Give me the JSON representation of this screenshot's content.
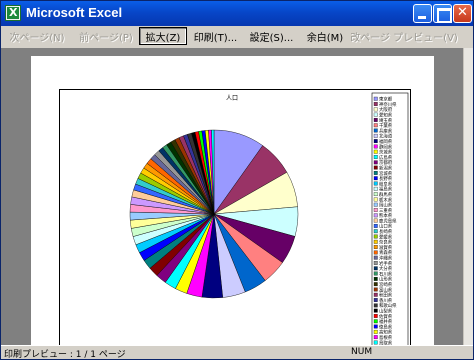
{
  "window": {
    "title": "Microsoft Excel"
  },
  "toolbar": {
    "next_page": "次ページ(N)",
    "prev_page": "前ページ(P)",
    "zoom": "拡大(Z)",
    "print": "印刷(T)...",
    "setup": "設定(S)...",
    "margins": "余白(M)",
    "page_break_preview": "改ページ プレビュー(V)"
  },
  "status": {
    "text": "印刷プレビュー : 1 / 1 ページ",
    "num": "NUM"
  },
  "chart_data": {
    "type": "pie",
    "title": "人口",
    "legend_position": "right",
    "categories": [
      "東京都",
      "神奈川県",
      "大阪府",
      "愛知県",
      "埼玉県",
      "千葉県",
      "兵庫県",
      "北海道",
      "福岡県",
      "静岡県",
      "茨城県",
      "広島県",
      "京都府",
      "新潟県",
      "宮城県",
      "長野県",
      "岐阜県",
      "福島県",
      "群馬県",
      "栃木県",
      "岡山県",
      "三重県",
      "熊本県",
      "鹿児島県",
      "山口県",
      "長崎県",
      "愛媛県",
      "奈良県",
      "滋賀県",
      "青森県",
      "沖縄県",
      "岩手県",
      "大分県",
      "石川県",
      "山形県",
      "宮崎県",
      "富山県",
      "秋田県",
      "香川県",
      "和歌山県",
      "山梨県",
      "佐賀県",
      "福井県",
      "徳島県",
      "高知県",
      "島根県",
      "鳥取県"
    ],
    "values": [
      12577,
      8792,
      8817,
      7255,
      7054,
      6056,
      5591,
      5628,
      5050,
      3792,
      2975,
      2877,
      2648,
      2431,
      2360,
      2196,
      2107,
      2091,
      2024,
      2017,
      1957,
      1867,
      1842,
      1753,
      1493,
      1479,
      1468,
      1421,
      1380,
      1437,
      1361,
      1385,
      1210,
      1174,
      1216,
      1153,
      1112,
      1146,
      1012,
      1036,
      885,
      866,
      822,
      810,
      796,
      742,
      607
    ],
    "colors": [
      "#9999ff",
      "#993366",
      "#ffffcc",
      "#ccffff",
      "#660066",
      "#ff8080",
      "#0066cc",
      "#ccccff",
      "#000080",
      "#ff00ff",
      "#ffff00",
      "#00ffff",
      "#800080",
      "#800000",
      "#008080",
      "#0000ff",
      "#00ccff",
      "#ccffff",
      "#ccffcc",
      "#ffff99",
      "#99ccff",
      "#ff99cc",
      "#cc99ff",
      "#ffcc99",
      "#3366ff",
      "#33cccc",
      "#99cc00",
      "#ffcc00",
      "#ff9900",
      "#ff6600",
      "#666699",
      "#969696",
      "#003366",
      "#339966",
      "#003300",
      "#333300",
      "#993300",
      "#993366",
      "#333399",
      "#333333",
      "#000000",
      "#ff0000",
      "#00ff00",
      "#0000ff",
      "#ffff00",
      "#ff00ff",
      "#00ffff"
    ]
  }
}
